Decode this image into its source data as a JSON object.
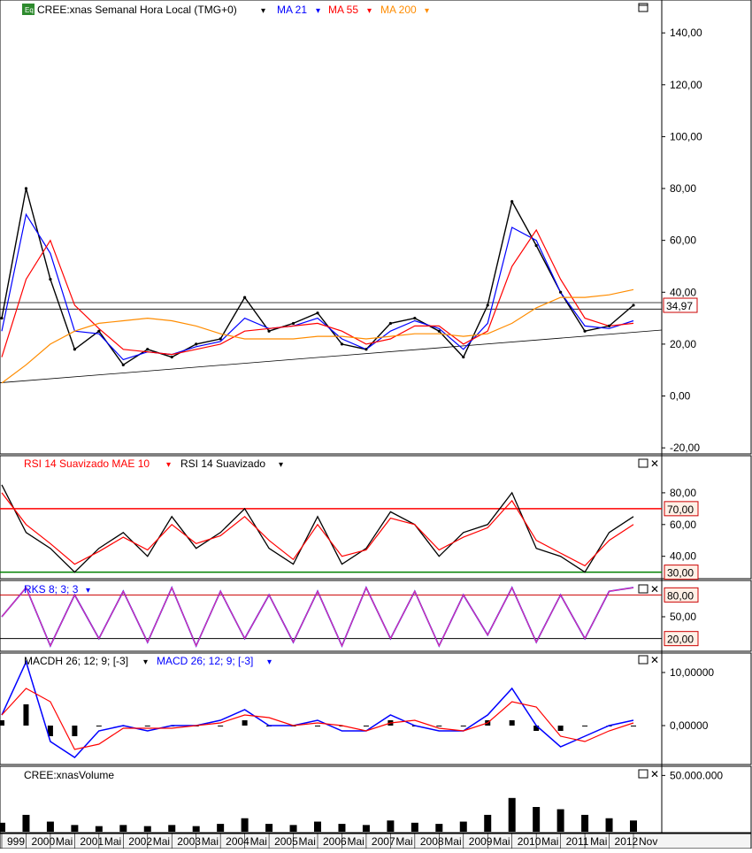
{
  "header": {
    "symbol_icon": "Eq",
    "symbol_label": "CREE:xnas Semanal Hora Local (TMG+0)",
    "ma21_label": "MA 21",
    "ma55_label": "MA 55",
    "ma200_label": "MA 200"
  },
  "rsi_header": {
    "smoothed_mae_label": "RSI 14 Suavizado MAE 10",
    "smoothed_label": "RSI 14 Suavizado"
  },
  "stoch_header": {
    "label": "RKS 8; 3; 3"
  },
  "macd_header": {
    "hist_label": "MACDH 26; 12; 9; [-3]",
    "line_label": "MACD 26; 12; 9; [-3]"
  },
  "volume_header": {
    "label": "CREE:xnasVolume"
  },
  "colors": {
    "ma21": "#0000ff",
    "ma55": "#ff0000",
    "ma200": "#ff8c00",
    "rsi": "#000000",
    "rsi_mae": "#ff0000",
    "ob_line": "#ff0000",
    "os_line": "#008000",
    "stoch_k": "#0000ff",
    "stoch_d": "#ff3399",
    "macd": "#0000ff",
    "macd_signal": "#ff0000"
  },
  "chart_data": [
    {
      "type": "line",
      "panel": "price",
      "y_ticks": [
        "140,00",
        "120,00",
        "100,00",
        "80,00",
        "60,00",
        "40,00",
        "20,00",
        "0,00",
        "-20,00"
      ],
      "ylim": [
        -22,
        152
      ],
      "last_price_label": "34,97",
      "last_price": 34.97,
      "x_years": [
        1999.5,
        2000,
        2000.5,
        2001,
        2001.5,
        2002,
        2002.5,
        2003,
        2003.5,
        2004,
        2004.5,
        2005,
        2005.5,
        2006,
        2006.5,
        2007,
        2007.5,
        2008,
        2008.5,
        2009,
        2009.5,
        2010,
        2010.5,
        2011,
        2011.5,
        2012,
        2012.5
      ],
      "series": [
        {
          "name": "CREE:xnas",
          "values": [
            30,
            80,
            45,
            18,
            25,
            12,
            18,
            15,
            20,
            22,
            38,
            25,
            28,
            32,
            20,
            18,
            28,
            30,
            25,
            15,
            35,
            75,
            58,
            40,
            25,
            27,
            35
          ]
        },
        {
          "name": "MA 21",
          "values": [
            25,
            70,
            55,
            25,
            24,
            14,
            17,
            16,
            19,
            21,
            30,
            26,
            27,
            30,
            22,
            18,
            25,
            29,
            26,
            18,
            28,
            65,
            60,
            40,
            27,
            26,
            29
          ]
        },
        {
          "name": "MA 55",
          "values": [
            15,
            45,
            60,
            35,
            26,
            18,
            17,
            16,
            18,
            20,
            25,
            26,
            27,
            28,
            25,
            20,
            22,
            27,
            27,
            20,
            25,
            50,
            64,
            45,
            30,
            27,
            28
          ]
        },
        {
          "name": "MA 200",
          "values": [
            5,
            12,
            20,
            25,
            28,
            29,
            30,
            29,
            27,
            24,
            22,
            22,
            22,
            23,
            23,
            22,
            23,
            24,
            24,
            23,
            24,
            28,
            34,
            38,
            38,
            39,
            41
          ]
        }
      ],
      "trendline": {
        "from": [
          1999.4,
          5
        ],
        "to": [
          2012.8,
          25
        ]
      },
      "h_lines": [
        36,
        33.5
      ]
    },
    {
      "type": "line",
      "panel": "rsi",
      "y_ticks": [
        "80,00",
        "70,00",
        "60,00",
        "40,00",
        "30,00"
      ],
      "ylim": [
        27,
        95
      ],
      "overbought": 70,
      "oversold": 30,
      "ob_label": "70,00",
      "os_label": "30,00",
      "series": [
        {
          "name": "RSI 14 Suavizado",
          "values": [
            85,
            55,
            45,
            30,
            45,
            55,
            40,
            65,
            45,
            55,
            70,
            45,
            35,
            65,
            35,
            45,
            68,
            60,
            40,
            55,
            60,
            80,
            45,
            40,
            30,
            55,
            65
          ]
        },
        {
          "name": "RSI 14 Suavizado MAE 10",
          "values": [
            80,
            60,
            48,
            35,
            43,
            52,
            44,
            60,
            48,
            53,
            65,
            50,
            38,
            60,
            40,
            44,
            64,
            60,
            44,
            52,
            58,
            75,
            50,
            42,
            34,
            50,
            60
          ]
        }
      ]
    },
    {
      "type": "line",
      "panel": "stochastic",
      "y_ticks": [
        "80,00",
        "50,00",
        "20,00"
      ],
      "ylim": [
        5,
        95
      ],
      "ob_label": "80,00",
      "os_label": "20,00",
      "series": [
        {
          "name": "RKS 8; 3; 3",
          "values": [
            50,
            90,
            10,
            80,
            20,
            85,
            15,
            90,
            10,
            85,
            20,
            80,
            15,
            85,
            10,
            90,
            20,
            85,
            10,
            80,
            25,
            90,
            15,
            80,
            20,
            85,
            90
          ]
        }
      ]
    },
    {
      "type": "line",
      "panel": "macd",
      "y_ticks": [
        "10,00000",
        "0,00000"
      ],
      "ylim": [
        -7,
        13
      ],
      "series": [
        {
          "name": "MACD 26; 12; 9; [-3]",
          "values": [
            2,
            12,
            -3,
            -6,
            -1,
            0,
            -1,
            0,
            0,
            1,
            3,
            0,
            0,
            1,
            -1,
            -1,
            2,
            0,
            -1,
            -1,
            2,
            7,
            0,
            -4,
            -2,
            0,
            1
          ]
        },
        {
          "name": "MACDH 26; 12; 9; [-3]",
          "values": [
            1,
            4,
            -2,
            -2,
            0,
            0,
            0,
            0,
            0,
            0,
            1,
            0,
            0,
            0,
            0,
            0,
            1,
            0,
            0,
            0,
            1,
            1,
            -1,
            -1,
            0,
            0,
            0
          ]
        }
      ]
    },
    {
      "type": "bar",
      "panel": "volume",
      "y_ticks": [
        "50.000.000"
      ],
      "ylim": [
        0,
        55000000
      ],
      "series": [
        {
          "name": "CREE:xnasVolume",
          "values": [
            8000000,
            15000000,
            9000000,
            6000000,
            5000000,
            6000000,
            5000000,
            6000000,
            5000000,
            7000000,
            12000000,
            7000000,
            6000000,
            9000000,
            7000000,
            6000000,
            10000000,
            8000000,
            7000000,
            9000000,
            15000000,
            30000000,
            22000000,
            20000000,
            15000000,
            12000000,
            10000000
          ]
        }
      ]
    }
  ],
  "x_axis": {
    "labels": [
      "999",
      "2000",
      "Mai",
      "2001",
      "Mai",
      "2002",
      "Mai",
      "2003",
      "Mai",
      "2004",
      "Mai",
      "2005",
      "Mai",
      "2006",
      "Mai",
      "2007",
      "Mai",
      "2008",
      "Mai",
      "2009",
      "Mai",
      "2010",
      "Mai",
      "2011",
      "Mai",
      "2012",
      "Nov"
    ]
  }
}
